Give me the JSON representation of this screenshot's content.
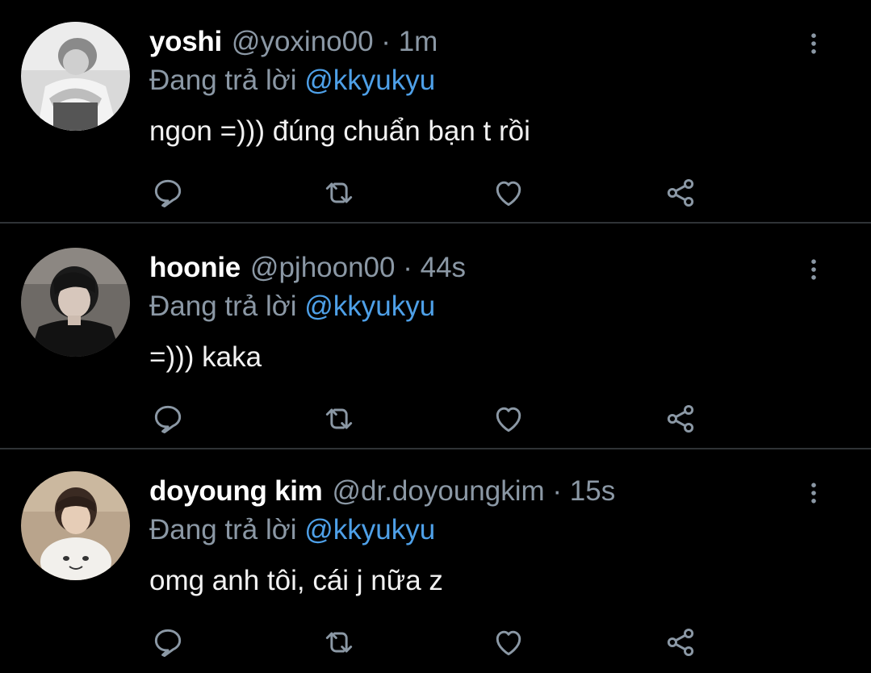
{
  "colors": {
    "background": "#000000",
    "separator": "#2f3336",
    "secondary_text": "#8b98a5",
    "mention": "#4ea0e8",
    "icon": "#8b98a5"
  },
  "icons": {
    "reply": "comment-bubble-icon",
    "retweet": "retweet-icon",
    "like": "heart-icon",
    "share": "share-icon",
    "more": "vertical-dots-icon"
  },
  "tweets": [
    {
      "name": "yoshi",
      "handle": "@yoxino00",
      "separator": "·",
      "time": "1m",
      "reply_prefix": "Đang trả lời",
      "reply_to": "@kkyukyu",
      "text": "ngon =))) đúng chuẩn bạn t rồi"
    },
    {
      "name": "hoonie",
      "handle": "@pjhoon00",
      "separator": "·",
      "time": "44s",
      "reply_prefix": "Đang trả lời",
      "reply_to": "@kkyukyu",
      "text": "=))) kaka"
    },
    {
      "name": "doyoung kim",
      "handle": "@dr.doyoungkim",
      "separator": "·",
      "time": "15s",
      "reply_prefix": "Đang trả lời",
      "reply_to": "@kkyukyu",
      "text": "omg anh tôi, cái j nữa z"
    }
  ]
}
